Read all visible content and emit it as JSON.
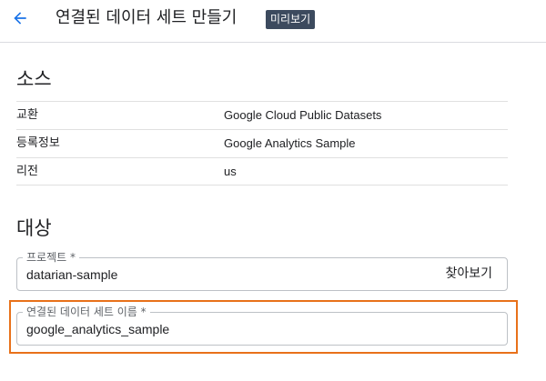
{
  "header": {
    "title": "연결된 데이터 세트 만들기",
    "badge": "미리보기"
  },
  "source": {
    "title": "소스",
    "rows": [
      {
        "label": "교환",
        "value": "Google Cloud Public Datasets"
      },
      {
        "label": "등록정보",
        "value": "Google Analytics Sample"
      },
      {
        "label": "리전",
        "value": "us"
      }
    ]
  },
  "destination": {
    "title": "대상",
    "project": {
      "label": "프로젝트 *",
      "value": "datarian-sample",
      "browse_label": "찾아보기"
    },
    "dataset": {
      "label": "연결된 데이터 세트 이름 *",
      "value": "google_analytics_sample"
    }
  },
  "colors": {
    "accent": "#1a73e8",
    "highlight": "#e8711a",
    "badge_bg": "#3c4a5e"
  },
  "icons": {
    "back": "arrow-back-icon"
  }
}
